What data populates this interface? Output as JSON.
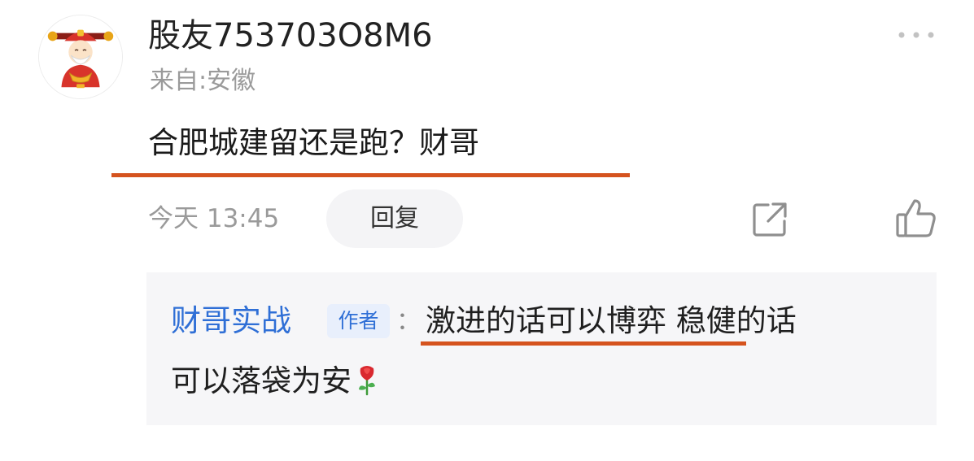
{
  "comment": {
    "username": "股友753703O8M6",
    "location": "来自:安徽",
    "text": "合肥城建留还是跑？财哥",
    "timestamp": "今天 13:45",
    "reply_button": "回复"
  },
  "reply": {
    "author": "财哥实战",
    "badge": "作者",
    "colon": "：",
    "line1": "激进的话可以博弈 稳健的话",
    "line2": "可以落袋为安",
    "emoji": "rose-icon"
  },
  "colors": {
    "underline": "#d5531e",
    "author_link": "#2f6fd6",
    "badge_bg": "#e8effc",
    "reply_bg": "#f6f6f8"
  }
}
